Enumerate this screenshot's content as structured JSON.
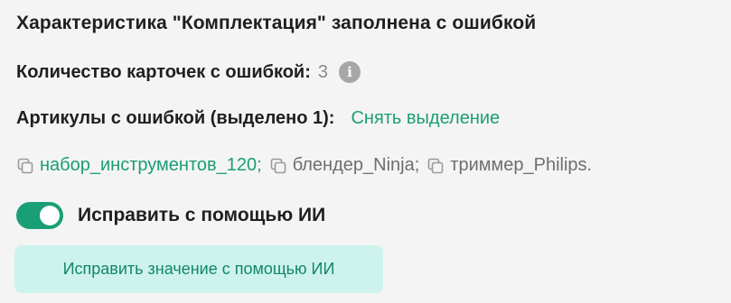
{
  "title": "Характеристика \"Комплектация\" заполнена с ошибкой",
  "count": {
    "label": "Количество карточек с ошибкой:",
    "value": "3",
    "info_icon": "info-icon"
  },
  "articles": {
    "label": "Артикулы с ошибкой (выделено 1):",
    "clear_selection": "Снять выделение",
    "items": [
      {
        "text": "набор_инструментов_120;",
        "selected": true,
        "icon": "copy-icon"
      },
      {
        "text": "блендер_Ninja;",
        "selected": false,
        "icon": "copy-icon"
      },
      {
        "text": "триммер_Philips.",
        "selected": false,
        "icon": "copy-icon"
      }
    ]
  },
  "toggle": {
    "label": "Исправить с помощью ИИ",
    "on": true
  },
  "ai_button": {
    "label": "Исправить значение с помощью ИИ"
  },
  "colors": {
    "accent": "#1a9e76",
    "button_bg": "#cdf3ec",
    "muted": "#6e6e6e"
  }
}
